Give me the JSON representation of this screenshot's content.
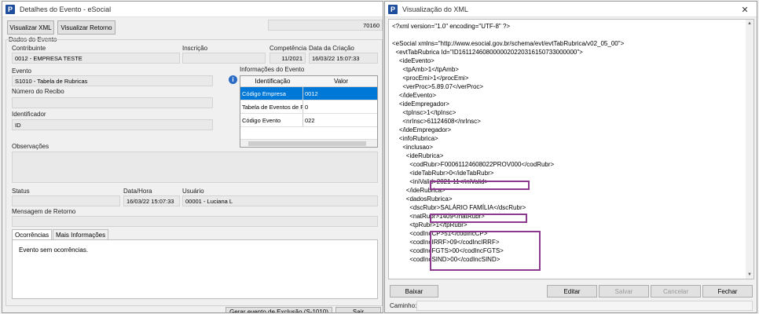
{
  "left": {
    "title": "Detalhes do Evento - eSocial",
    "buttons": {
      "xml": "Visualizar XML",
      "retorno": "Visualizar Retorno"
    },
    "top_value": "70160",
    "section": "Dados do Evento",
    "labels": {
      "contribuinte": "Contribuinte",
      "inscricao": "Inscrição",
      "competencia": "Competência",
      "data_criacao": "Data da Criação",
      "evento": "Evento",
      "num_recibo": "Número do Recibo",
      "identificador": "Identificador",
      "observacoes": "Observações",
      "status": "Status",
      "data_hora": "Data/Hora",
      "usuario": "Usuário",
      "msg_retorno": "Mensagem de Retorno",
      "info_evento": "Informações do Evento"
    },
    "values": {
      "contribuinte": "0012 - EMPRESA TESTE",
      "competencia": "11/2021",
      "data_criacao": "16/03/22 15:07:33",
      "evento": "S1010 - Tabela de Rubricas",
      "identificador": "ID",
      "data_hora": "16/03/22 15:07:33",
      "usuario": "00001 - Luciana L"
    },
    "grid": {
      "headers": [
        "Identificação",
        "Valor"
      ],
      "rows": [
        {
          "id": "Código Empresa",
          "valor": "0012"
        },
        {
          "id": "Tabela de Eventos de F",
          "valor": "0"
        },
        {
          "id": "Código Evento",
          "valor": "022"
        }
      ]
    },
    "tabs": [
      "Ocorrências",
      "Mais Informações"
    ],
    "ocorrencias": "Evento sem ocorrências.",
    "bottom_buttons": [
      "Gerar evento de Exclusão (S-1010)",
      "Sair"
    ]
  },
  "right": {
    "title": "Visualização do XML",
    "xml_lines": [
      "<?xml version=\"1.0\" encoding=\"UTF-8\" ?>",
      "",
      "<eSocial xmlns=\"http://www.esocial.gov.br/schema/evt/evtTabRubrica/v02_05_00\">",
      "  <evtTabRubrica Id=\"ID1611246080000020220316150733000000\">",
      "    <ideEvento>",
      "      <tpAmb>1</tpAmb>",
      "      <procEmi>1</procEmi>",
      "      <verProc>5.89.07</verProc>",
      "    </ideEvento>",
      "    <ideEmpregador>",
      "      <tpInsc>1</tpInsc>",
      "      <nrInsc>61124608</nrInsc>",
      "    </ideEmpregador>",
      "    <infoRubrica>",
      "      <inclusao>",
      "        <ideRubrica>",
      "          <codRubr>F00061124608022PROV000</codRubr>",
      "          <ideTabRubr>0</ideTabRubr>",
      "          <iniValid>2021-11</iniValid>",
      "        </ideRubrica>",
      "        <dadosRubrica>",
      "          <dscRubr>SALÁRIO FAMÍLIA</dscRubr>",
      "          <natRubr>1409</natRubr>",
      "          <tpRubr>1</tpRubr>",
      "          <codIncCP>51</codIncCP>",
      "          <codIncIRRF>09</codIncIRRF>",
      "          <codIncFGTS>00</codIncFGTS>",
      "          <codIncSIND>00</codIncSIND>"
    ],
    "buttons": [
      "Baixar",
      "Editar",
      "Salvar",
      "Cancelar",
      "Fechar"
    ],
    "caminho_label": "Caminho:"
  },
  "colors": {
    "highlight": "#8b3a8f",
    "selection": "#0078d7",
    "app_icon": "#1f4e9c"
  }
}
